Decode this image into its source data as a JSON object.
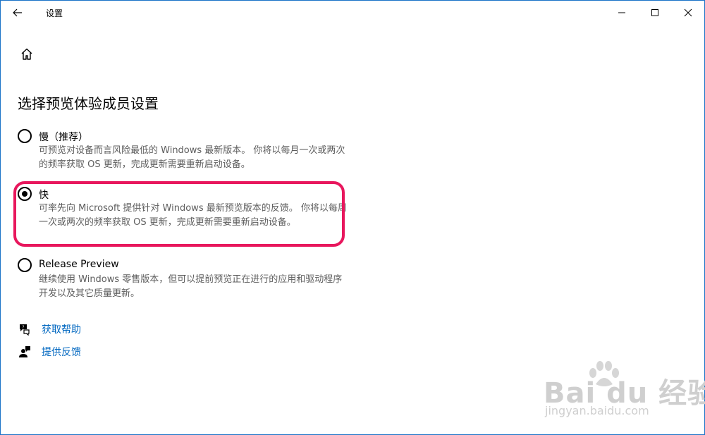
{
  "window": {
    "title": "设置"
  },
  "page": {
    "title": "选择预览体验成员设置"
  },
  "options": [
    {
      "label": "慢（推荐）",
      "description": "可预览对设备而言风险最低的 Windows 最新版本。 你将以每月一次或两次的频率获取 OS 更新，完成更新需要重新启动设备。",
      "selected": false
    },
    {
      "label": "快",
      "description": "可率先向 Microsoft 提供针对 Windows 最新预览版本的反馈。 你将以每周一次或两次的频率获取 OS 更新，完成更新需要重新启动设备。",
      "selected": true
    },
    {
      "label": "Release Preview",
      "description": "继续使用 Windows 零售版本，但可以提前预览正在进行的应用和驱动程序开发以及其它质量更新。",
      "selected": false
    }
  ],
  "links": {
    "help": "获取帮助",
    "feedback": "提供反馈"
  },
  "watermark": {
    "brand": "Bai du 经验",
    "url": "jingyan.baidu.com"
  },
  "colors": {
    "link": "#0067c0",
    "highlight": "#e8175d",
    "window_border": "#1a73c8"
  },
  "icons": [
    "back-arrow-icon",
    "minimize-icon",
    "maximize-icon",
    "close-icon",
    "home-icon",
    "help-chat-icon",
    "feedback-person-icon"
  ]
}
